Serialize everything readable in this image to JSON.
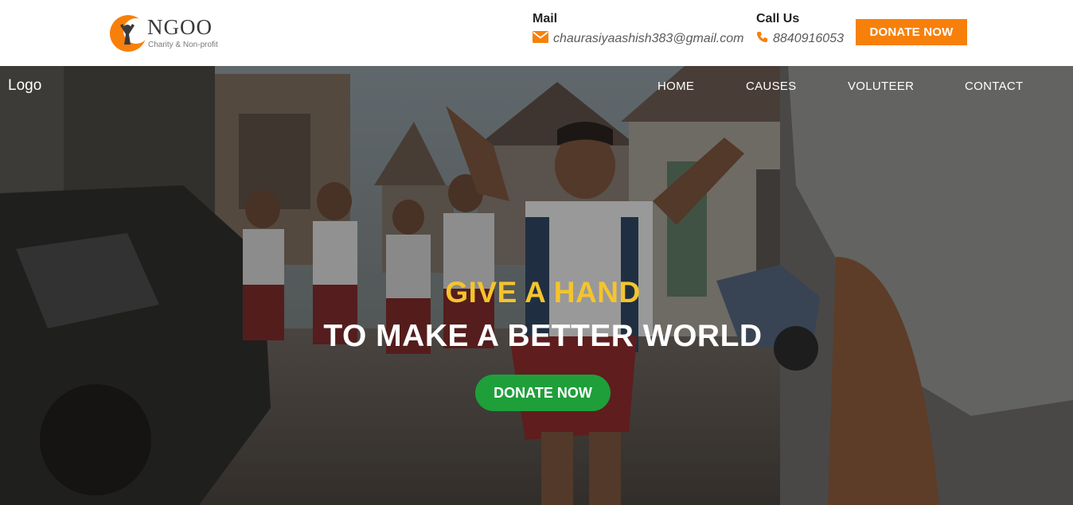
{
  "brand": {
    "name": "NGOO",
    "tagline": "Charity & Non-profit",
    "accent": "#f7800b"
  },
  "contact": {
    "mail_label": "Mail",
    "mail_value": "chaurasiyaashish383@gmail.com",
    "mail_icon": "envelope-icon",
    "call_label": "Call Us",
    "call_value": "8840916053",
    "call_icon": "phone-icon"
  },
  "header": {
    "donate_label": "DONATE NOW",
    "donate_color": "#f7800b"
  },
  "nav": {
    "logo": "Logo",
    "items": [
      {
        "label": "HOME"
      },
      {
        "label": "CAUSES"
      },
      {
        "label": "VOLUTEER"
      },
      {
        "label": "CONTACT"
      }
    ]
  },
  "hero": {
    "headline_1": "GIVE A HAND",
    "headline_2": "TO MAKE A BETTER WORLD",
    "headline_1_color": "#f5c42d",
    "donate_label": "DONATE NOW",
    "donate_color": "#1e9f3a"
  }
}
